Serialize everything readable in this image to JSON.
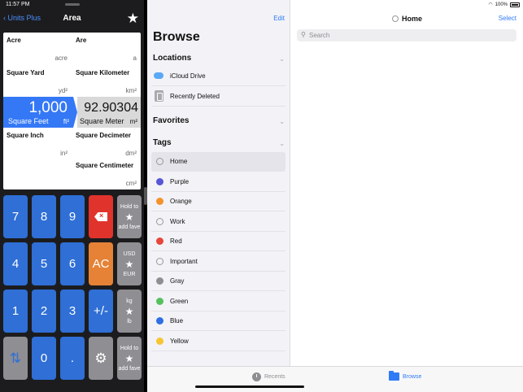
{
  "status": {
    "time": "11:57 PM",
    "battery": "100%"
  },
  "units_app": {
    "back_label": "Units Plus",
    "title": "Area",
    "units_left": [
      {
        "name": "Acre",
        "abbr": "acre"
      },
      {
        "name": "Square Yard",
        "abbr": "yd²"
      },
      {
        "name": "Square Inch",
        "abbr": "in²"
      }
    ],
    "units_right": [
      {
        "name": "Are",
        "abbr": "a"
      },
      {
        "name": "Square Kilometer",
        "abbr": "km²"
      },
      {
        "name": "Square Decimeter",
        "abbr": "dm²"
      },
      {
        "name": "Square Centimeter",
        "abbr": "cm²"
      }
    ],
    "input": {
      "value": "1,000",
      "unit": "Square Feet",
      "abbr": "ft²"
    },
    "output": {
      "value": "92.90304",
      "unit": "Square Meter",
      "abbr": "m²"
    },
    "keys": {
      "k7": "7",
      "k8": "8",
      "k9": "9",
      "k4": "4",
      "k5": "5",
      "k6": "6",
      "k1": "1",
      "k2": "2",
      "k3": "3",
      "k0": "0",
      "dot": ".",
      "ac": "AC",
      "plusminus": "+/-"
    },
    "fav_keys": [
      {
        "top": "Hold to",
        "bottom": "add fave"
      },
      {
        "top": "USD",
        "bottom": "EUR"
      },
      {
        "top": "kg",
        "bottom": "lb"
      },
      {
        "top": "Hold to",
        "bottom": "add fave"
      }
    ]
  },
  "files_app": {
    "edit_label": "Edit",
    "browse_title": "Browse",
    "sections": {
      "locations": "Locations",
      "favorites": "Favorites",
      "tags": "Tags"
    },
    "locations": [
      {
        "label": "iCloud Drive",
        "icon": "cloud-icon"
      },
      {
        "label": "Recently Deleted",
        "icon": "trash-icon"
      }
    ],
    "tags": [
      {
        "label": "Home",
        "color": ""
      },
      {
        "label": "Purple",
        "color": "#5856d6"
      },
      {
        "label": "Orange",
        "color": "#f5922b"
      },
      {
        "label": "Work",
        "color": ""
      },
      {
        "label": "Red",
        "color": "#e8463b"
      },
      {
        "label": "Important",
        "color": ""
      },
      {
        "label": "Gray",
        "color": "#8e8e93"
      },
      {
        "label": "Green",
        "color": "#55c15e"
      },
      {
        "label": "Blue",
        "color": "#2f6fe4"
      },
      {
        "label": "Yellow",
        "color": "#f6c531"
      }
    ],
    "content_title": "Home",
    "select_label": "Select",
    "search_placeholder": "Search",
    "tabs": {
      "recents": "Recents",
      "browse": "Browse"
    }
  }
}
